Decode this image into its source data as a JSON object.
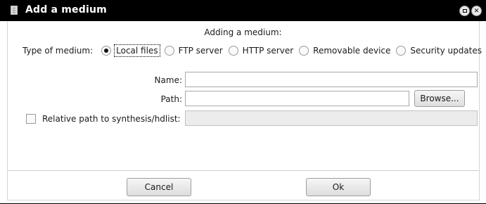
{
  "window": {
    "title": "Add a medium",
    "heading": "Adding a medium:"
  },
  "type_of_medium": {
    "label": "Type of medium:",
    "options": [
      {
        "label": "Local files",
        "selected": true
      },
      {
        "label": "FTP server",
        "selected": false
      },
      {
        "label": "HTTP server",
        "selected": false
      },
      {
        "label": "Removable device",
        "selected": false
      },
      {
        "label": "Security updates",
        "selected": false
      }
    ]
  },
  "name": {
    "label": "Name:",
    "value": ""
  },
  "path": {
    "label": "Path:",
    "value": "",
    "browse_label": "Browse..."
  },
  "relative_path": {
    "label": "Relative path to synthesis/hdlist:",
    "checked": false,
    "value": ""
  },
  "buttons": {
    "cancel": "Cancel",
    "ok": "Ok"
  },
  "icons": {
    "app": "app-icon",
    "maximize": "maximize-icon",
    "close": "close-icon"
  }
}
